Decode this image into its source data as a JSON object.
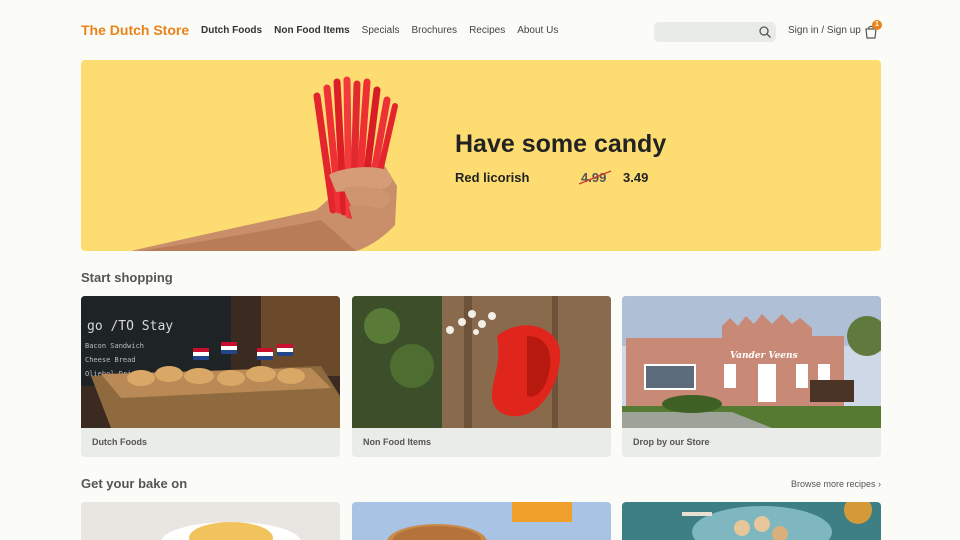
{
  "header": {
    "logo": "The Dutch Store",
    "nav": [
      {
        "label": "Dutch Foods",
        "bold": true
      },
      {
        "label": "Non Food Items",
        "bold": true
      },
      {
        "label": "Specials",
        "bold": false
      },
      {
        "label": "Brochures",
        "bold": false
      },
      {
        "label": "Recipes",
        "bold": false
      },
      {
        "label": "About Us",
        "bold": false
      }
    ],
    "search_placeholder": "",
    "signin": "Sign in / Sign up",
    "cart_count": "1"
  },
  "hero": {
    "title": "Have some candy",
    "product": "Red licorish",
    "old_price": "4.99",
    "new_price": "3.49"
  },
  "shopping": {
    "title": "Start shopping",
    "cards": [
      {
        "label": "Dutch Foods"
      },
      {
        "label": "Non Food Items"
      },
      {
        "label": "Drop by our Store"
      }
    ]
  },
  "bake": {
    "title": "Get your bake on",
    "browse": "Browse more recipes ›"
  },
  "colors": {
    "accent": "#e98319",
    "hero_bg": "#fddd72",
    "page_bg": "#fbfcf7"
  }
}
